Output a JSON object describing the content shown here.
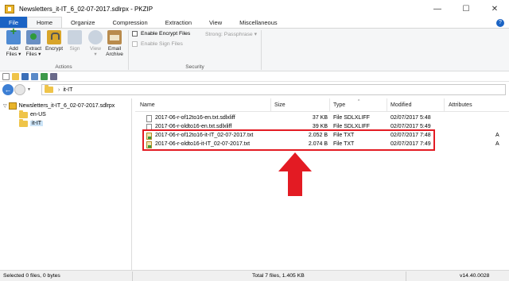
{
  "window": {
    "title": "Newsletters_it-IT_6_02-07-2017.sdlrpx - PKZIP",
    "minimize": "—",
    "maximize": "☐",
    "close": "✕"
  },
  "ribbon_tabs": [
    "File",
    "Home",
    "Organize",
    "Compression",
    "Extraction",
    "View",
    "Miscellaneous"
  ],
  "help_label": "?",
  "actions": {
    "add": [
      "Add",
      "Files ▾"
    ],
    "extract": [
      "Extract",
      "Files ▾"
    ],
    "encrypt": "Encrypt",
    "sign": "Sign",
    "view": [
      "View",
      "▾"
    ],
    "email": [
      "Email",
      "Archive"
    ],
    "group_label": "Actions"
  },
  "security": {
    "enable_encrypt": "Enable Encrypt Files",
    "enable_sign": "Enable Sign Files",
    "strong": "Strong: Passphrase ▾",
    "group_label": "Security"
  },
  "address": {
    "back_icon": "←",
    "dropdown": "▼",
    "separator": "›",
    "path": "it-IT"
  },
  "tree": {
    "expander": "▽",
    "root": "Newsletters_it-IT_6_02-07-2017.sdlrpx",
    "children": [
      "en-US",
      "it-IT"
    ],
    "selected": "it-IT"
  },
  "columns": {
    "name": "Name",
    "size": "Size",
    "type": "Type",
    "modified": "Modified",
    "attributes": "Attributes",
    "sort_indicator": "^"
  },
  "files": [
    {
      "name": "2017-06-r-of12to16-en.txt.sdlxliff",
      "size": "37 KB",
      "type": "File SDLXLIFF",
      "modified": "02/07/2017  5:48",
      "attr": "",
      "icon": "file-icon"
    },
    {
      "name": "2017-06-r-oldto16-en.txt.sdlxliff",
      "size": "39 KB",
      "type": "File SDLXLIFF",
      "modified": "02/07/2017  5:49",
      "attr": "",
      "icon": "file-icon"
    },
    {
      "name": "2017-06-r-of12to16-it-IT_02-07-2017.txt",
      "size": "2.052 B",
      "type": "File TXT",
      "modified": "02/07/2017  7:48",
      "attr": "A",
      "icon": "txt-file-icon"
    },
    {
      "name": "2017-06-r-oldto16-it-IT_02-07-2017.txt",
      "size": "2.074 B",
      "type": "File TXT",
      "modified": "02/07/2017  7:49",
      "attr": "A",
      "icon": "txt-file-icon"
    }
  ],
  "status": {
    "selected": "Selected 0 files, 0 bytes",
    "total": "Total 7 files, 1.405 KB",
    "version": "v14.40.0028"
  },
  "colors": {
    "accent": "#1a63c4",
    "highlight": "#e31b23"
  }
}
